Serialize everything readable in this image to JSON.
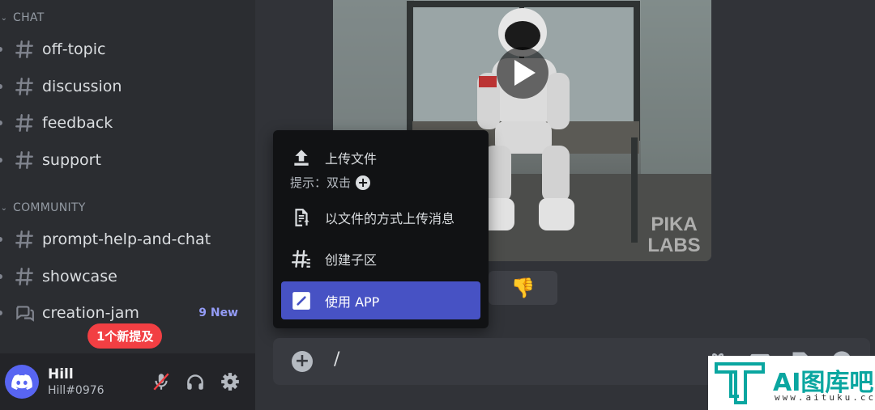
{
  "sidebar": {
    "categories": [
      {
        "label": "CHAT"
      },
      {
        "label": "COMMUNITY"
      }
    ],
    "channels": [
      {
        "label": "off-topic"
      },
      {
        "label": "discussion"
      },
      {
        "label": "feedback"
      },
      {
        "label": "support"
      },
      {
        "label": "prompt-help-and-chat"
      },
      {
        "label": "showcase"
      },
      {
        "label": "creation-jam",
        "badge": "9 New"
      }
    ],
    "mention_pill": "1个新提及"
  },
  "user": {
    "name": "Hill",
    "tag": "Hill#0976"
  },
  "video": {
    "watermark_text": "PIKA LABS"
  },
  "reaction": {
    "emoji": "👎"
  },
  "attach_menu": {
    "items": [
      {
        "label": "上传文件",
        "icon": "upload-icon"
      },
      {
        "label": "以文件的方式上传消息",
        "icon": "file-upload-icon"
      },
      {
        "label": "创建子区",
        "icon": "thread-icon"
      },
      {
        "label": "使用 APP",
        "icon": "app-icon"
      }
    ],
    "hint": "提示：双击"
  },
  "composer": {
    "value": "/"
  },
  "site_watermark": {
    "title": "AI图库吧",
    "url": "www.aituku.cc"
  },
  "colors": {
    "accent": "#4752c4",
    "blurple": "#5865f2",
    "mention": "#f23f43",
    "new_badge": "#949cf7"
  }
}
